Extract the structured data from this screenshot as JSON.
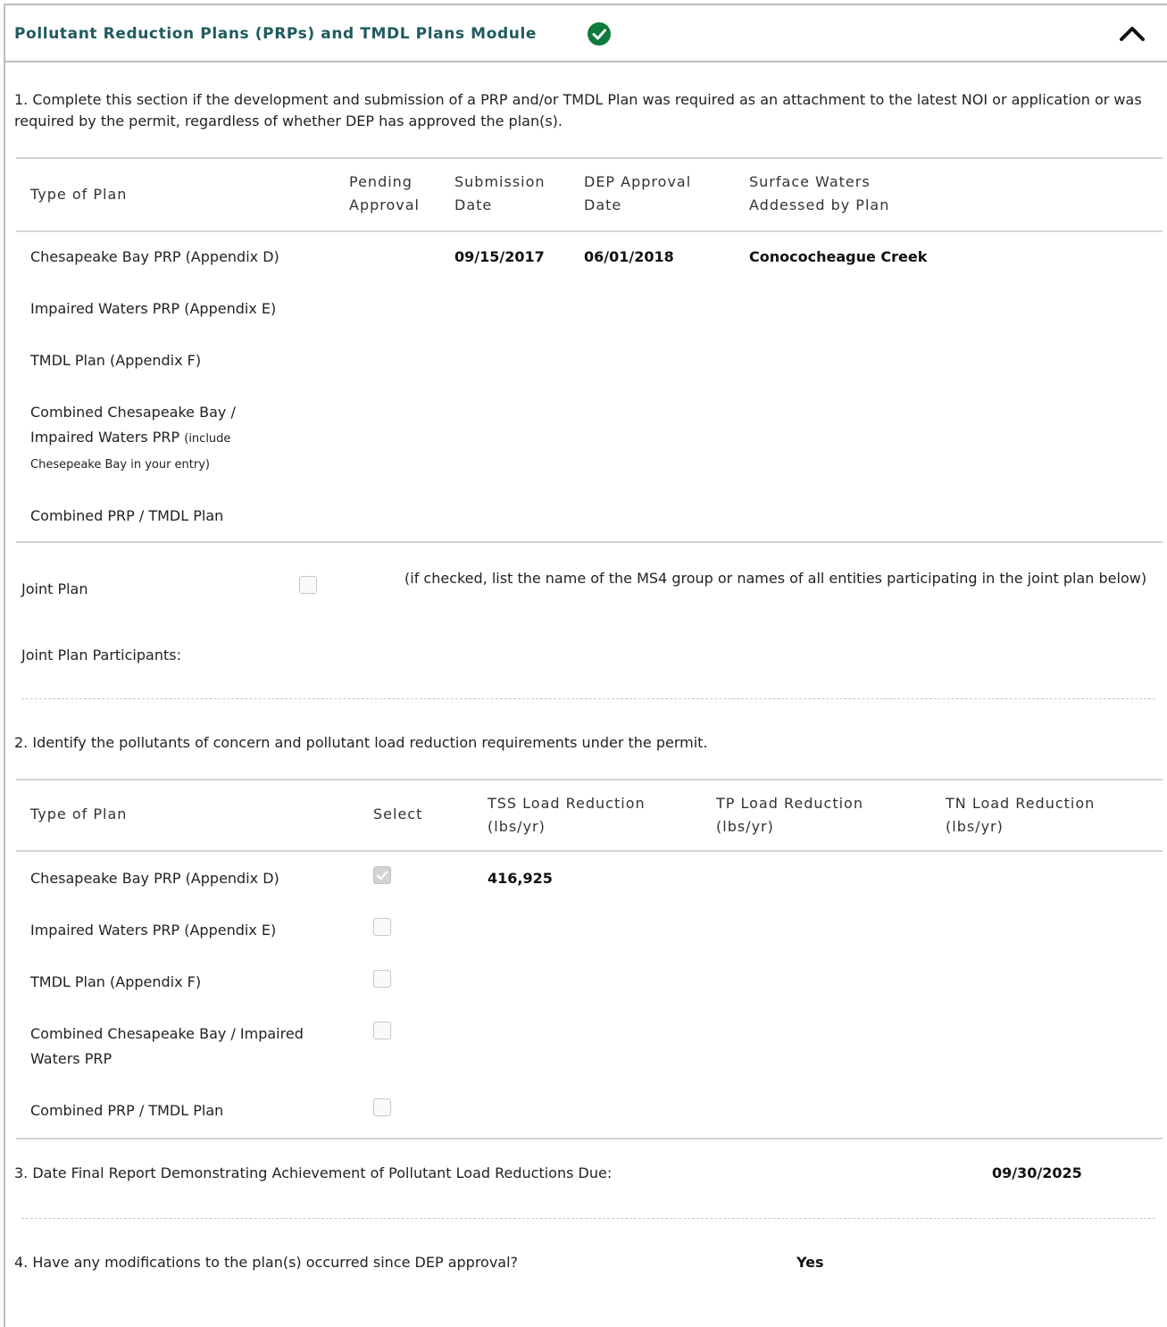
{
  "header": {
    "title": "Pollutant Reduction Plans (PRPs) and TMDL Plans Module",
    "status_icon": "check-circle-icon",
    "status_color": "#0e7a3c",
    "collapse_icon": "chevron-up-icon"
  },
  "section1": {
    "instruction": "1. Complete this section if the development and submission of a PRP and/or TMDL Plan was required as an attachment to the latest NOI or application or was required by the permit, regardless of whether DEP has approved the plan(s).",
    "columns": {
      "type_of_plan": "Type of Plan",
      "pending_line1": "Pending",
      "pending_line2": "Approval",
      "submission_line1": "Submission",
      "submission_line2": "Date",
      "approval_line1": "DEP Approval",
      "approval_line2": "Date",
      "waters_line1": "Surface Waters",
      "waters_line2": "Addessed by Plan"
    },
    "rows": [
      {
        "type": "Chesapeake Bay PRP (Appendix D)",
        "submission_date": "09/15/2017",
        "approval_date": "06/01/2018",
        "surface_waters": "Conococheague Creek"
      },
      {
        "type": "Impaired Waters PRP (Appendix E)"
      },
      {
        "type": "TMDL Plan (Appendix F)"
      },
      {
        "type_line1": "Combined Chesapeake Bay /",
        "type_line2": "Impaired Waters PRP",
        "type_note_a": "(include",
        "type_note_b": "Chesepeake Bay in your entry)"
      },
      {
        "type": "Combined PRP / TMDL Plan"
      }
    ],
    "joint_plan_label": "Joint Plan",
    "joint_plan_checked": false,
    "joint_plan_hint": "(if checked, list the name of the MS4 group or names of all entities participating in the joint plan below)",
    "joint_participants_label": "Joint Plan Participants:"
  },
  "section2": {
    "instruction": "2. Identify the pollutants of concern and pollutant load reduction requirements under the permit.",
    "columns": {
      "type_of_plan": "Type of Plan",
      "select": "Select",
      "tss_line1": "TSS Load Reduction",
      "tss_line2": "(lbs/yr)",
      "tp_line1": "TP Load Reduction",
      "tp_line2": "(lbs/yr)",
      "tn_line1": "TN Load Reduction",
      "tn_line2": "(lbs/yr)"
    },
    "rows": [
      {
        "type": "Chesapeake Bay PRP (Appendix D)",
        "selected": true,
        "tss": "416,925"
      },
      {
        "type": "Impaired Waters PRP (Appendix E)",
        "selected": false
      },
      {
        "type": "TMDL Plan (Appendix F)",
        "selected": false
      },
      {
        "type_line1": "Combined Chesapeake Bay / Impaired",
        "type_line2": "Waters PRP",
        "selected": false
      },
      {
        "type": "Combined PRP / TMDL Plan",
        "selected": false
      }
    ]
  },
  "section3": {
    "label": "3. Date Final Report Demonstrating Achievement of Pollutant Load Reductions Due:",
    "value": "09/30/2025"
  },
  "section4": {
    "label": "4. Have any modifications to the plan(s) occurred since DEP approval?",
    "value": "Yes"
  }
}
